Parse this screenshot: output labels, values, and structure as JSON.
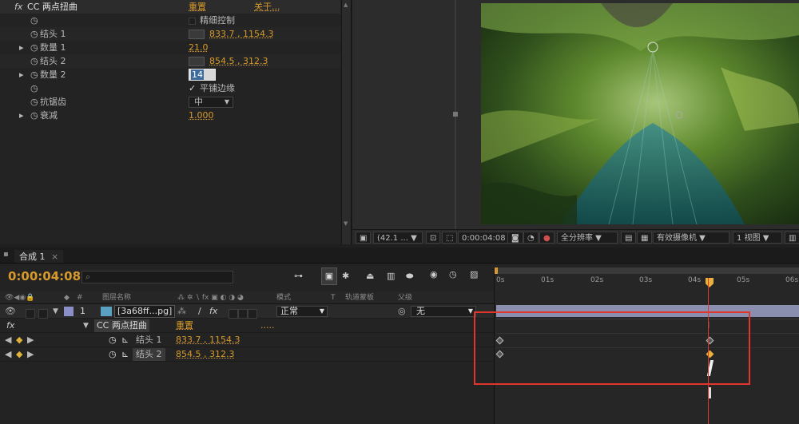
{
  "effect_controls": {
    "effect_name": "CC 两点扭曲",
    "reset_label": "重置",
    "about_label": "关于...",
    "fine_control_label": "精细控制",
    "rows": [
      {
        "label": "结头 1",
        "value": "833.7 , 1154.3"
      },
      {
        "label": "数量 1",
        "value": "21.0"
      },
      {
        "label": "结头 2",
        "value": "854.5 , 312.3"
      },
      {
        "label": "数量 2",
        "value": "14"
      },
      {
        "label": "平铺边缘",
        "value": ""
      },
      {
        "label": "抗锯齿",
        "value": "中"
      },
      {
        "label": "衰减",
        "value": "1.000"
      }
    ]
  },
  "viewer_bar": {
    "zoom": "(42.1 ...",
    "timecode": "0:00:04:08",
    "resolution": "全分辨率",
    "camera": "有效摄像机",
    "views": "1 视图"
  },
  "timeline": {
    "tab_label": "合成 1",
    "timecode": "0:00:04:08",
    "search_placeholder": "",
    "columns": {
      "index": "#",
      "layer_name": "图层名称",
      "mode": "模式",
      "t": "T",
      "track_matte": "轨道蒙板",
      "parent": "父级"
    },
    "layer": {
      "index": "1",
      "name": "[3a68ff...pg]",
      "mode": "正常",
      "parent": "无"
    },
    "effect_row": {
      "fx": "fx",
      "name": "CC 两点扭曲",
      "reset": "重置"
    },
    "prop_rows": [
      {
        "label": "结头 1",
        "value": "833.7 , 1154.3"
      },
      {
        "label": "结头 2",
        "value": "854.5 , 312.3"
      }
    ],
    "ruler_ticks": [
      "0s",
      "01s",
      "02s",
      "03s",
      "04s",
      "05s",
      "06s"
    ]
  },
  "colors": {
    "accent_orange": "#d79a2c",
    "playhead_red": "#e0362b",
    "highlight_box": "#e0362b",
    "selection_blue": "#3d6a9c"
  }
}
